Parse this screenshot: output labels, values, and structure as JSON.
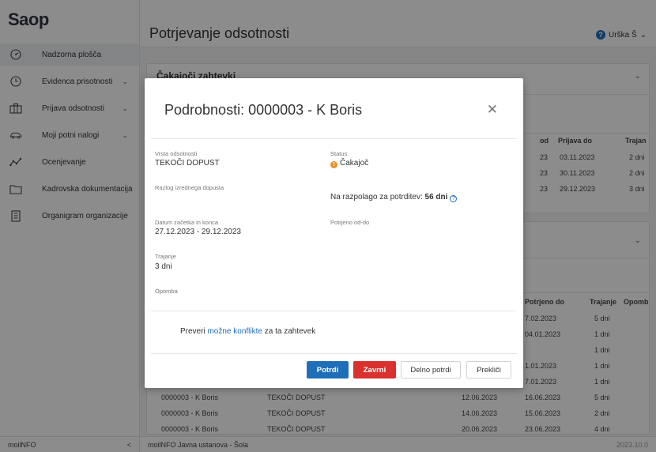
{
  "app": {
    "logo": "Saop"
  },
  "sidebar": {
    "items": [
      {
        "label": "Nadzorna plošča",
        "icon": "dashboard-icon",
        "active": true,
        "chevron": false
      },
      {
        "label": "Evidenca prisotnosti",
        "icon": "clock-icon",
        "chevron": true
      },
      {
        "label": "Prijava odsotnosti",
        "icon": "briefcase-icon",
        "chevron": true
      },
      {
        "label": "Moji potni nalogi",
        "icon": "car-icon",
        "chevron": true
      },
      {
        "label": "Ocenjevanje",
        "icon": "chart-icon",
        "chevron": false
      },
      {
        "label": "Kadrovska dokumentacija",
        "icon": "folder-icon",
        "chevron": false
      },
      {
        "label": "Organigram organizacije",
        "icon": "building-icon",
        "chevron": false
      }
    ],
    "footer_label": "moilNFO",
    "collapse_glyph": "<"
  },
  "header": {
    "title": "Potrjevanje odsotnosti",
    "user": "Urška Š",
    "help_glyph": "?",
    "chev_glyph": "⌄"
  },
  "panel1": {
    "title": "Čakajoči zahtevki",
    "columns": [
      "od",
      "Prijava do",
      "Trajan"
    ],
    "rows": [
      [
        "23",
        "03.11.2023",
        "2 dni"
      ],
      [
        "23",
        "30.11.2023",
        "2 dni"
      ],
      [
        "23",
        "29.12.2023",
        "3 dni"
      ]
    ]
  },
  "panel2": {
    "columns": [
      "Potrjeno do",
      "Trajanje",
      "Opomb"
    ],
    "rows": [
      [
        "7.02.2023",
        "5 dni"
      ],
      [
        "04.01.2023",
        "1 dni"
      ],
      [
        "",
        "1 dni"
      ],
      [
        "1.01.2023",
        "1 dni"
      ],
      [
        "7.01.2023",
        "1 dni"
      ]
    ],
    "full_rows": [
      [
        "0000003 - K Boris",
        "TEKOČI DOPUST",
        "12.06.2023",
        "16.06.2023",
        "5 dni"
      ],
      [
        "0000003 - K Boris",
        "TEKOČI DOPUST",
        "14.06.2023",
        "15.06.2023",
        "2 dni"
      ],
      [
        "0000003 - K Boris",
        "TEKOČI DOPUST",
        "20.06.2023",
        "23.06.2023",
        "4 dni"
      ]
    ]
  },
  "footer": {
    "text": "moilNFO   Javna ustanova - Šola",
    "version": "2023.10.0"
  },
  "modal": {
    "title": "Podrobnosti: 0000003 - K Boris",
    "close_glyph": "✕",
    "fields": {
      "vrsta_label": "Vrsta odsotnosti",
      "vrsta_value": "TEKOČI DOPUST",
      "status_label": "Status",
      "status_value": "Čakajoč",
      "razlog_label": "Razlog izrednega dopusta",
      "razpolago_text": "Na razpolago za potrditev:",
      "razpolago_value": "56 dni",
      "datum_label": "Datum začetka in konca",
      "datum_value": "27.12.2023 - 29.12.2023",
      "potrjeno_label": "Potrjeno od-do",
      "trajanje_label": "Trajanje",
      "trajanje_value": "3 dni",
      "opomba_label": "Opomba"
    },
    "conflict": {
      "prefix": "Preveri",
      "link": "možne konflikte",
      "suffix": "za ta zahtevek"
    },
    "buttons": {
      "confirm": "Potrdi",
      "reject": "Zavrni",
      "partial": "Delno potrdi",
      "cancel": "Prekliči"
    }
  },
  "colors": {
    "primary": "#1f6fb8",
    "danger": "#d9322e",
    "warning": "#e8912e"
  }
}
